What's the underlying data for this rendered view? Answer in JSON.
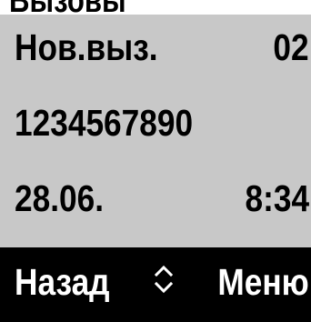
{
  "status": {
    "partial_text": "Вызовы"
  },
  "display": {
    "line1": {
      "label": "Нов.выз.",
      "count": "02"
    },
    "line2": {
      "number": "1234567890"
    },
    "line3": {
      "date": "28.06.",
      "time": "8:34"
    }
  },
  "softkeys": {
    "left_label": "Назад",
    "nav_icon": "up-down-arrows-icon",
    "right_label": "Меню"
  },
  "colors": {
    "display_background": "#c8c8c8",
    "softkey_background": "#000000",
    "softkey_text": "#ffffff",
    "display_text": "#000000"
  }
}
